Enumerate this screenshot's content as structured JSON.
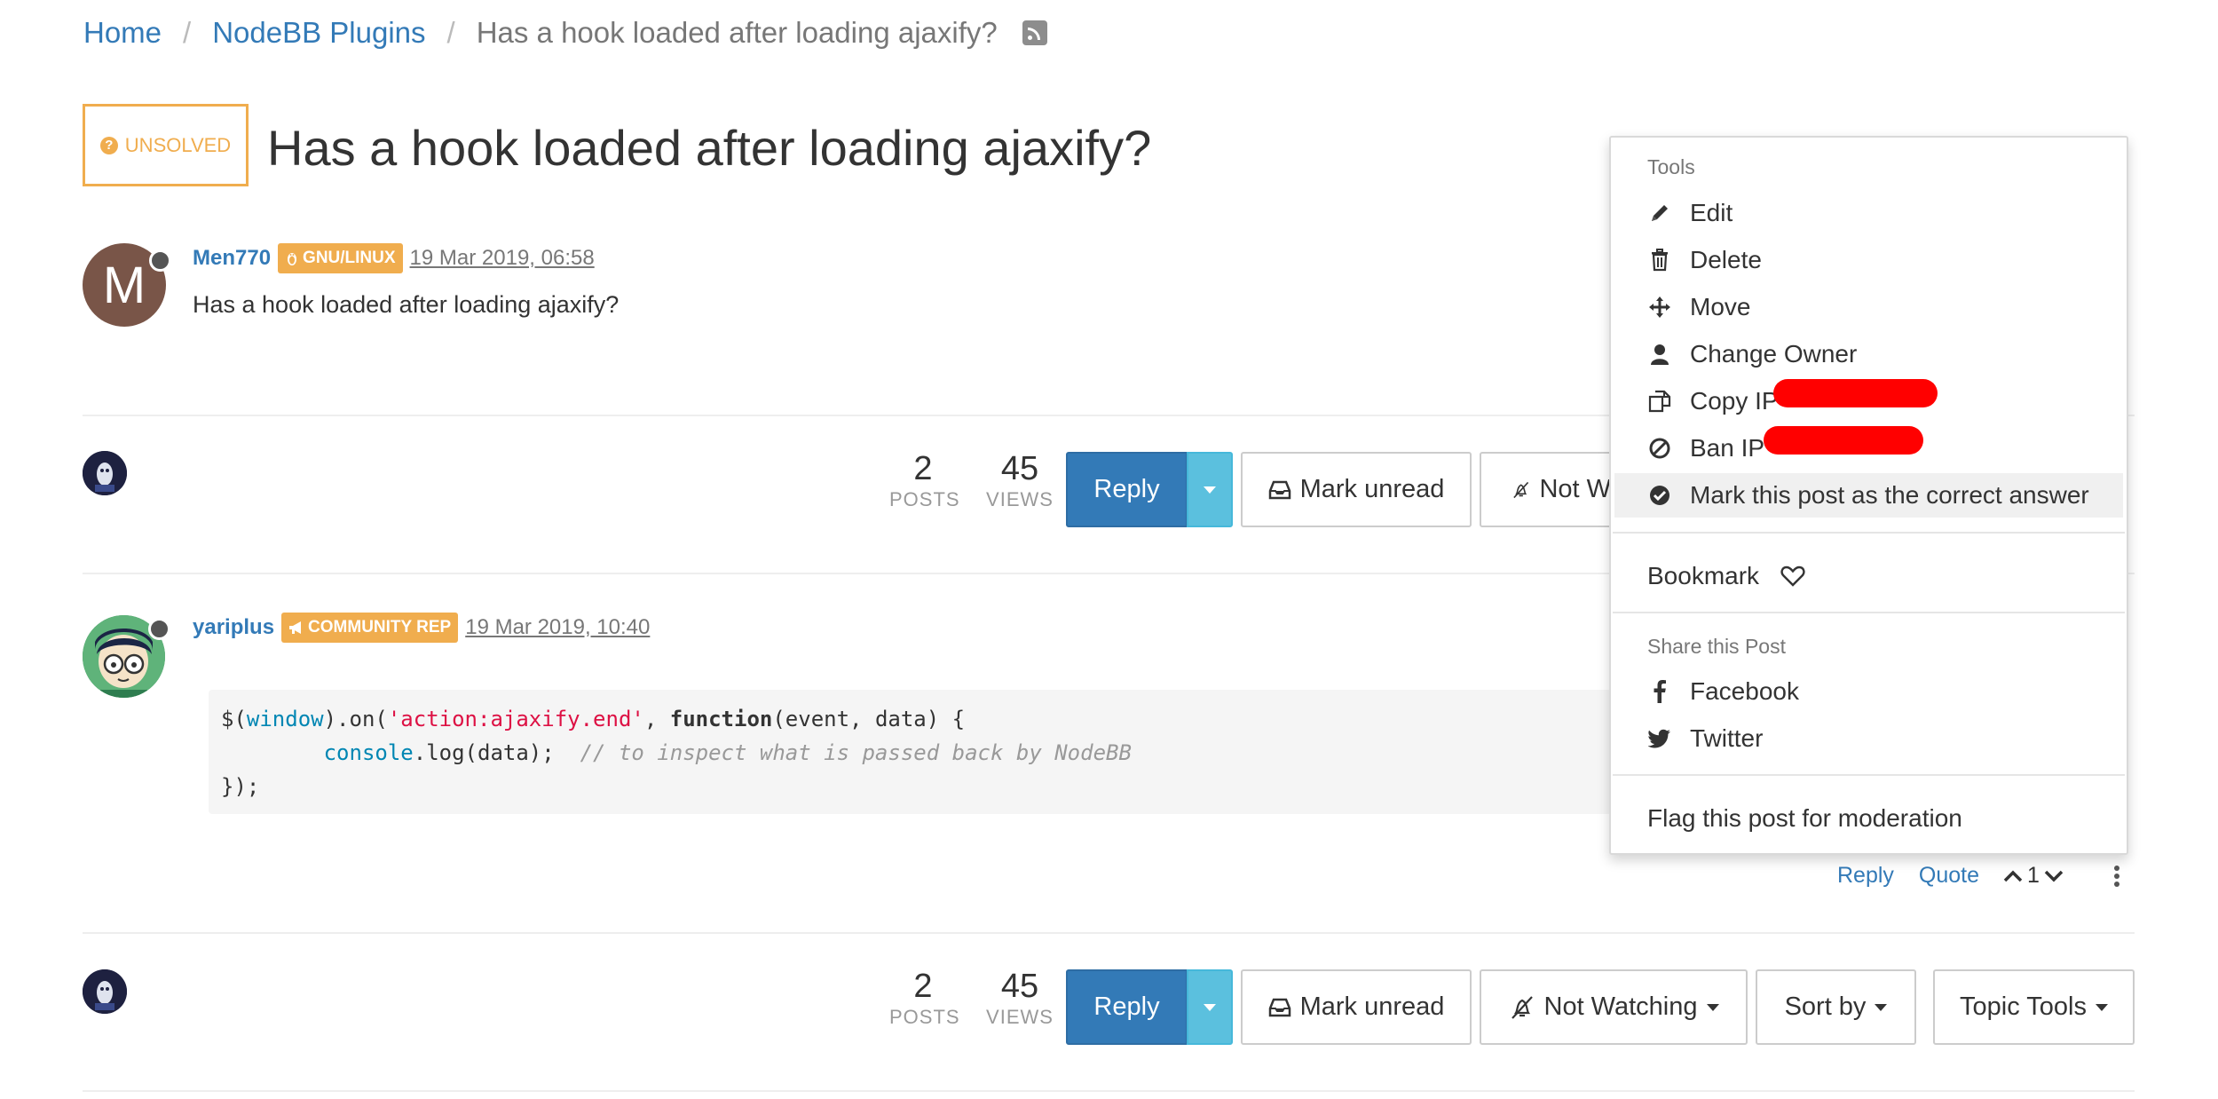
{
  "breadcrumb": {
    "home": "Home",
    "category": "NodeBB Plugins",
    "current": "Has a hook loaded after loading ajaxify?",
    "separator": "/"
  },
  "topic": {
    "status_badge": "UNSOLVED",
    "title": "Has a hook loaded after loading ajaxify?"
  },
  "posts": [
    {
      "avatar_letter": "M",
      "avatar_color": "#795548",
      "username": "Men770",
      "badge": "GNU/LINUX",
      "timestamp": "19 Mar 2019, 06:58",
      "content": "Has a hook loaded after loading ajaxify?"
    },
    {
      "username": "yariplus",
      "badge": "COMMUNITY REP",
      "timestamp": "19 Mar 2019, 10:40",
      "code": {
        "line1": [
          "$(",
          "window",
          ").on(",
          "'action:ajaxify.end'",
          ", ",
          "function",
          "(event, data) {"
        ],
        "line2": [
          "        ",
          "console",
          ".log(data);  ",
          "// to inspect what is passed back by NodeBB"
        ],
        "line3": "});"
      },
      "actions": {
        "reply": "Reply",
        "quote": "Quote",
        "votes": "1"
      }
    }
  ],
  "topic_bar": {
    "posts_count": "2",
    "posts_label": "POSTS",
    "views_count": "45",
    "views_label": "VIEWS",
    "reply": "Reply",
    "mark_unread": "Mark unread",
    "not_watching": "Not Watching",
    "not_watching_clipped": "Not W",
    "sort_by": "Sort by",
    "topic_tools": "Topic Tools"
  },
  "post_menu": {
    "tools_header": "Tools",
    "edit": "Edit",
    "delete": "Delete",
    "move": "Move",
    "change_owner": "Change Owner",
    "copy_ip": "Copy IP",
    "ban_ip": "Ban IP",
    "mark_correct": "Mark this post as the correct answer",
    "bookmark": "Bookmark",
    "share_header": "Share this Post",
    "facebook": "Facebook",
    "twitter": "Twitter",
    "flag": "Flag this post for moderation"
  },
  "colors": {
    "link": "#337ab7",
    "reply_button": "#337ab7",
    "reply_caret": "#5bc0de",
    "badge": "#f0ad4e",
    "redaction": "#ff0000"
  }
}
